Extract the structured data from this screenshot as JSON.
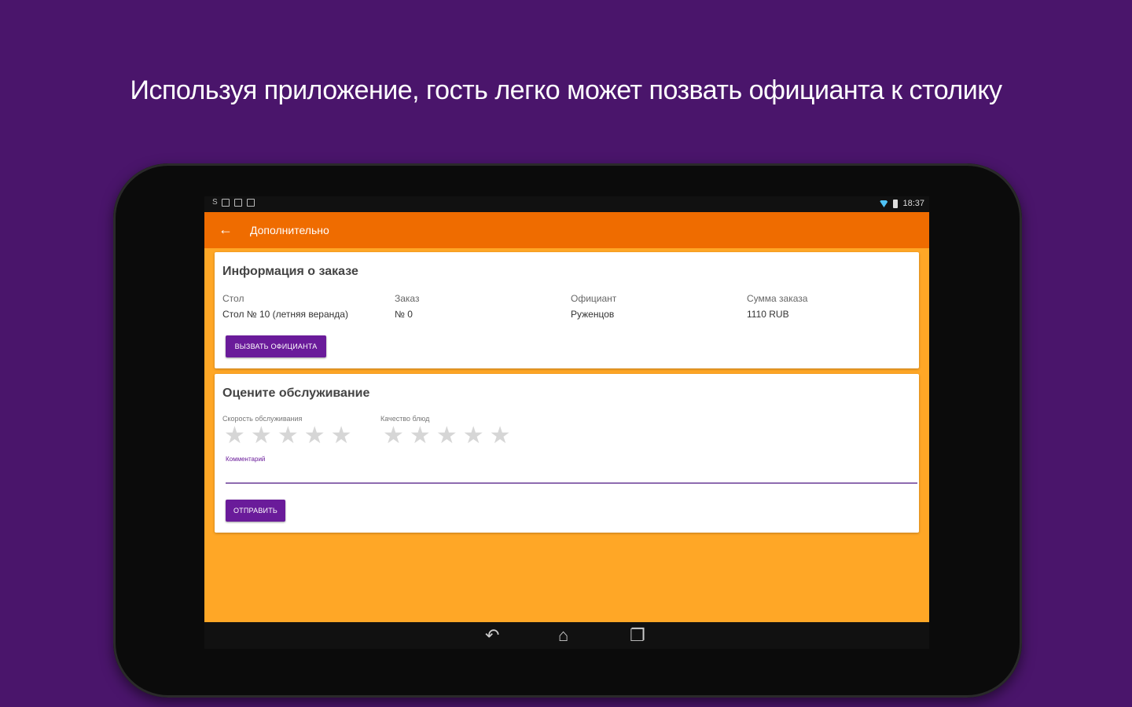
{
  "headline": "Используя приложение, гость легко может позвать официанта к столику",
  "statusbar": {
    "left_icons": [
      "notification-icon",
      "image-icon",
      "gallery-icon",
      "android-icon"
    ],
    "time": "18:37"
  },
  "toolbar": {
    "title": "Дополнительно"
  },
  "order_card": {
    "title": "Информация о заказе",
    "fields": [
      {
        "label": "Стол",
        "value": "Стол № 10 (летняя веранда)"
      },
      {
        "label": "Заказ",
        "value": "№ 0"
      },
      {
        "label": "Официант",
        "value": "Руженцов"
      },
      {
        "label": "Сумма заказа",
        "value": "1110 RUB"
      }
    ],
    "call_button": "вызвать официанта"
  },
  "rate_card": {
    "title": "Оцените обслуживание",
    "speed_label": "Скорость обслуживания",
    "speed_rating": 0,
    "quality_label": "Качество блюд",
    "quality_rating": 0,
    "max_rating": 5,
    "comment_label": "Комментарий",
    "comment_value": "",
    "send_button": "отправить"
  },
  "colors": {
    "background": "#4a156b",
    "toolbar": "#ef6c00",
    "content": "#ffa726",
    "button": "#6a1b9a",
    "star_empty": "#d6d6d6"
  }
}
